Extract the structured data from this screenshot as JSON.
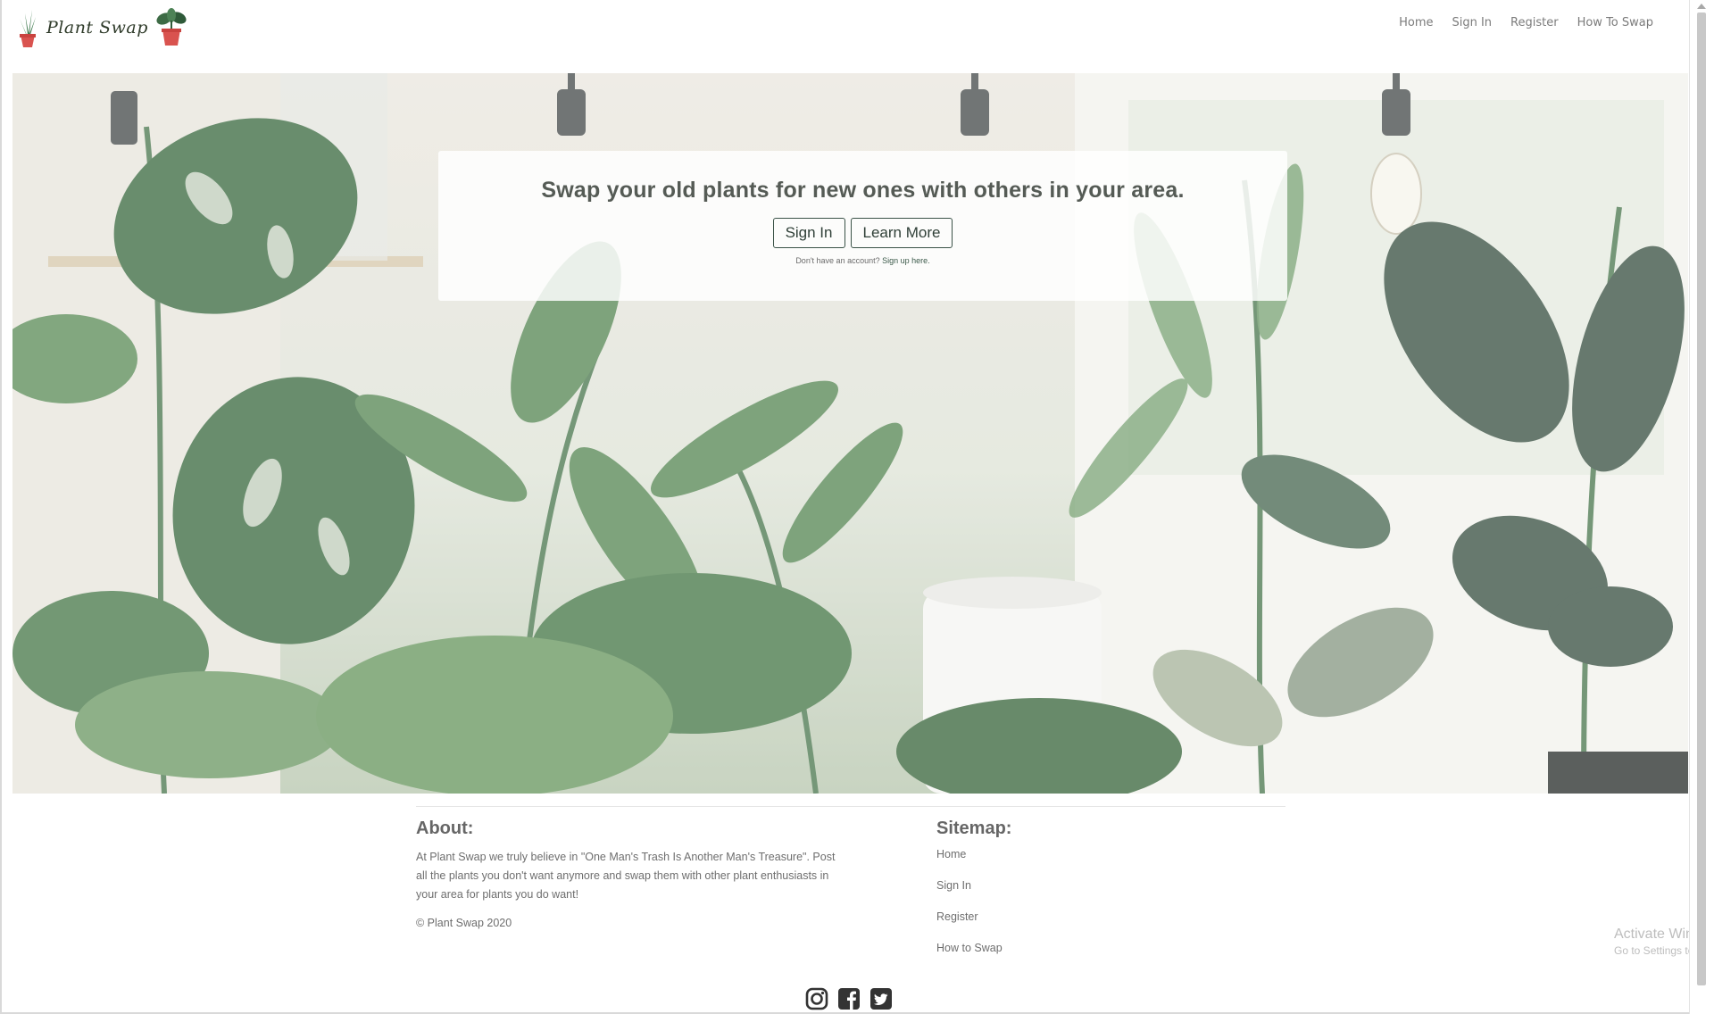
{
  "brand": {
    "name": "Plant Swap"
  },
  "nav": {
    "items": [
      "Home",
      "Sign In",
      "Register",
      "How To Swap"
    ]
  },
  "hero": {
    "headline": "Swap your old plants for new ones with others in your area.",
    "signin_label": "Sign In",
    "learn_more_label": "Learn More",
    "signup_prefix": "Don't have an account?",
    "signup_link": "Sign up here."
  },
  "footer": {
    "about_heading": "About:",
    "about_text": "At Plant Swap we truly believe in \"One Man's Trash Is Another Man's Treasure\". Post all the plants you don't want anymore and swap them with other plant enthusiasts in your area for plants you do want!",
    "copyright": "© Plant Swap 2020",
    "sitemap_heading": "Sitemap:",
    "sitemap": [
      "Home",
      "Sign In",
      "Register",
      "How to Swap"
    ],
    "social": [
      "instagram-icon",
      "facebook-icon",
      "twitter-icon"
    ]
  },
  "watermark": {
    "line1": "Activate Windows",
    "line2": "Go to Settings to activate Windows."
  },
  "colors": {
    "accent": "#3a5247",
    "leaf": "#4f7a52",
    "text": "#6e6e6e"
  }
}
